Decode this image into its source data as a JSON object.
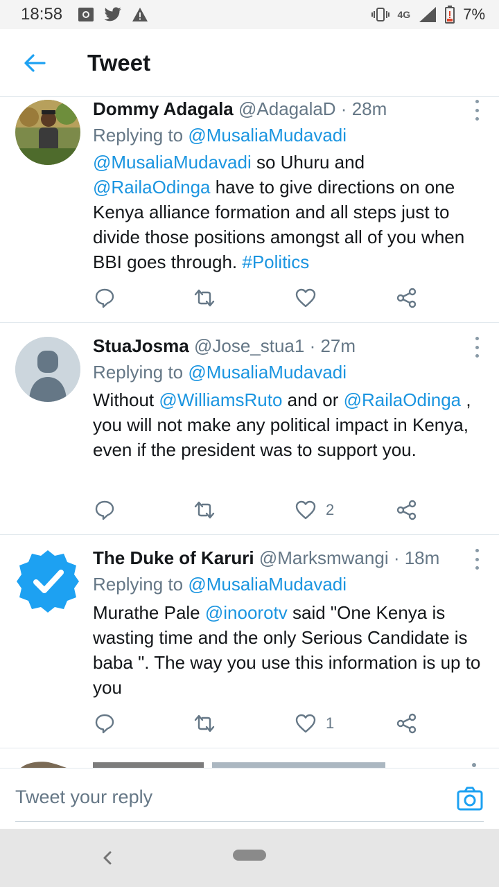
{
  "status_bar": {
    "time": "18:58",
    "network": "4G",
    "battery": "7%",
    "icons": [
      "screenshot-icon",
      "twitter-icon",
      "warning-icon",
      "vibrate-icon",
      "signal-icon",
      "battery-icon"
    ]
  },
  "header": {
    "title": "Tweet",
    "accent": "#1da1f2"
  },
  "tweets": [
    {
      "name": "Dommy Adagala",
      "handle": "@AdagalaD · 28m",
      "replying_prefix": "Replying to ",
      "replying_to": "@MusaliaMudavadi",
      "body": [
        {
          "t": "@MusaliaMudavadi",
          "link": true
        },
        {
          "t": " so Uhuru and ",
          "link": false
        },
        {
          "t": "@RailaOdinga",
          "link": true
        },
        {
          "t": "  have to give directions on one Kenya alliance formation and all steps just to divide those positions amongst all of you when BBI goes through. ",
          "link": false
        },
        {
          "t": "#Politics",
          "link": true
        }
      ],
      "likes": ""
    },
    {
      "name": "StuaJosma",
      "handle": "@Jose_stua1 · 27m",
      "replying_prefix": "Replying to ",
      "replying_to": "@MusaliaMudavadi",
      "body": [
        {
          "t": "Without ",
          "link": false
        },
        {
          "t": "@WilliamsRuto",
          "link": true
        },
        {
          "t": " and or ",
          "link": false
        },
        {
          "t": "@RailaOdinga",
          "link": true
        },
        {
          "t": " , you will not make any political impact in Kenya, even if the president was to support you.",
          "link": false
        }
      ],
      "likes": "2"
    },
    {
      "name": "The Duke of Karuri",
      "handle": "@Marksmwangi · 18m",
      "replying_prefix": "Replying to ",
      "replying_to": "@MusaliaMudavadi",
      "body": [
        {
          "t": "Murathe Pale ",
          "link": false
        },
        {
          "t": "@inoorotv",
          "link": true
        },
        {
          "t": "  said \"One Kenya is wasting time and the only Serious Candidate is baba \". The way you use this information is up to you",
          "link": false
        }
      ],
      "likes": "1"
    }
  ],
  "reply_bar": {
    "placeholder": "Tweet your reply"
  }
}
